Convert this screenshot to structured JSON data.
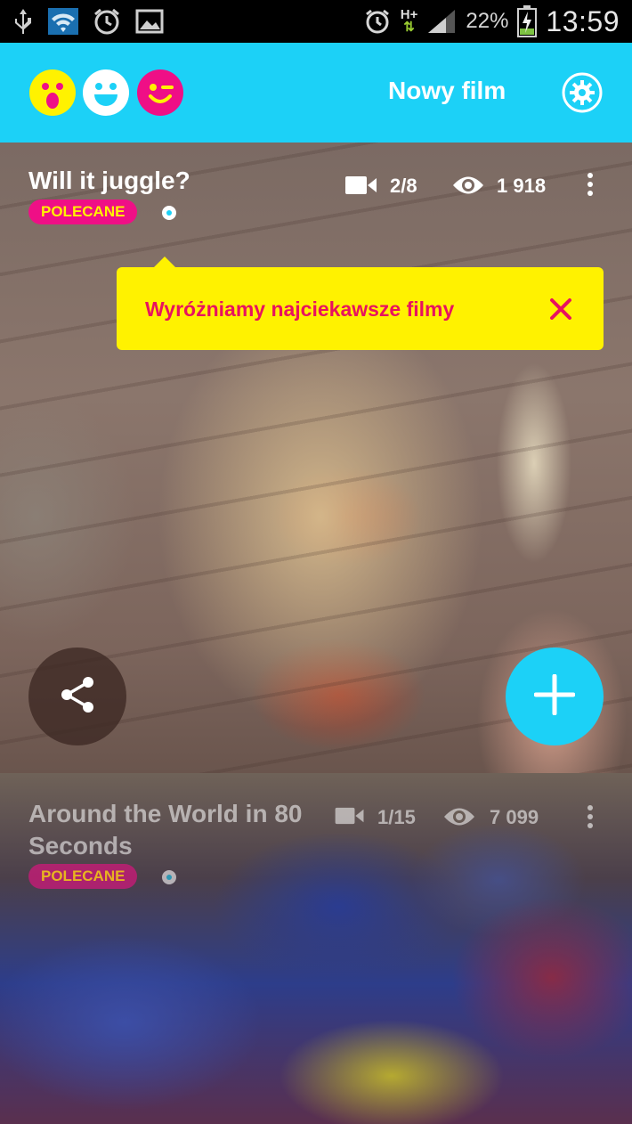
{
  "status_bar": {
    "left_icons": [
      "usb-icon",
      "wifi-icon",
      "alarm-icon",
      "gallery-icon"
    ],
    "network": "H+",
    "battery_percent": "22%",
    "time": "13:59"
  },
  "app_bar": {
    "new_film_label": "Nowy film",
    "faces": [
      "surprised-face-icon",
      "happy-face-icon",
      "wink-face-icon"
    ],
    "colors": {
      "bar": "#1cd1f7",
      "yellow": "#fff200",
      "pink": "#ef0f86"
    }
  },
  "tooltip": {
    "text": "Wyróżniamy najciekawsze filmy"
  },
  "videos": [
    {
      "title": "Will it juggle?",
      "badge": "POLECANE",
      "clips": "2/8",
      "views": "1 918"
    },
    {
      "title": "Around the World in 80 Seconds",
      "badge": "POLECANE",
      "clips": "1/15",
      "views": "7 099"
    }
  ]
}
